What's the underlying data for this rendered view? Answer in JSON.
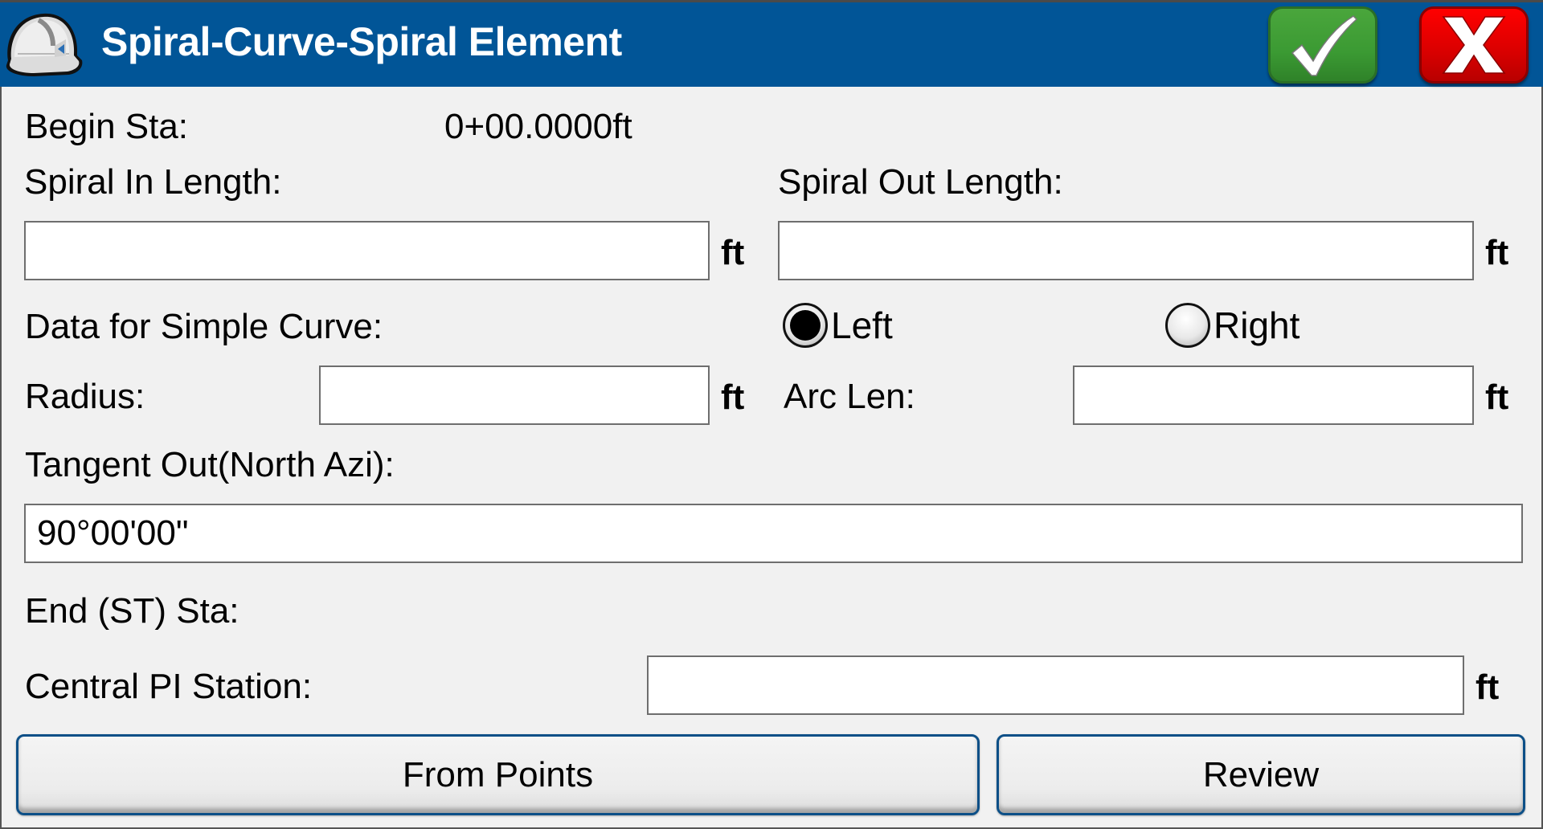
{
  "window": {
    "title": "Spiral-Curve-Spiral Element",
    "app_icon": "hard-hat-icon",
    "ok_icon": "checkmark-icon",
    "cancel_icon": "x-close-icon",
    "colors": {
      "titlebar": "#015597",
      "ok": "#3b9a33",
      "cancel": "#e00000"
    }
  },
  "form": {
    "begin_sta": {
      "label": "Begin Sta:",
      "value": "0+00.0000ft"
    },
    "spiral_in": {
      "label": "Spiral In Length:",
      "value": "",
      "unit": "ft"
    },
    "spiral_out": {
      "label": "Spiral Out Length:",
      "value": "",
      "unit": "ft"
    },
    "simple_curve": {
      "label": "Data for Simple Curve:"
    },
    "direction": {
      "options": [
        {
          "label": "Left",
          "selected": true
        },
        {
          "label": "Right",
          "selected": false
        }
      ]
    },
    "radius": {
      "label": "Radius:",
      "value": "",
      "unit": "ft"
    },
    "arc_len": {
      "label": "Arc Len:",
      "value": "",
      "unit": "ft"
    },
    "tangent_out": {
      "label": "Tangent Out(North Azi):",
      "value": "90°00'00\""
    },
    "end_sta": {
      "label": "End (ST) Sta:",
      "value": ""
    },
    "central_pi": {
      "label": "Central PI Station:",
      "value": "",
      "unit": "ft"
    }
  },
  "buttons": {
    "from_points": "From Points",
    "review": "Review"
  }
}
